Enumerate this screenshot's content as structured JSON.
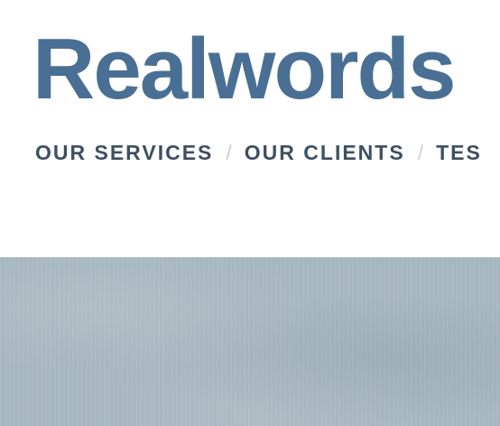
{
  "site": {
    "logo_text": "Realwords",
    "brand_color": "#4a6f94"
  },
  "nav": {
    "items": [
      {
        "label": "OUR SERVICES"
      },
      {
        "label": "OUR CLIENTS"
      },
      {
        "label": "TES"
      }
    ],
    "separator": "/",
    "text_color": "#3d4f62",
    "separator_color": "#c9cfd6"
  },
  "hero": {
    "background_color": "#a9b9c2",
    "texture": "concrete"
  }
}
